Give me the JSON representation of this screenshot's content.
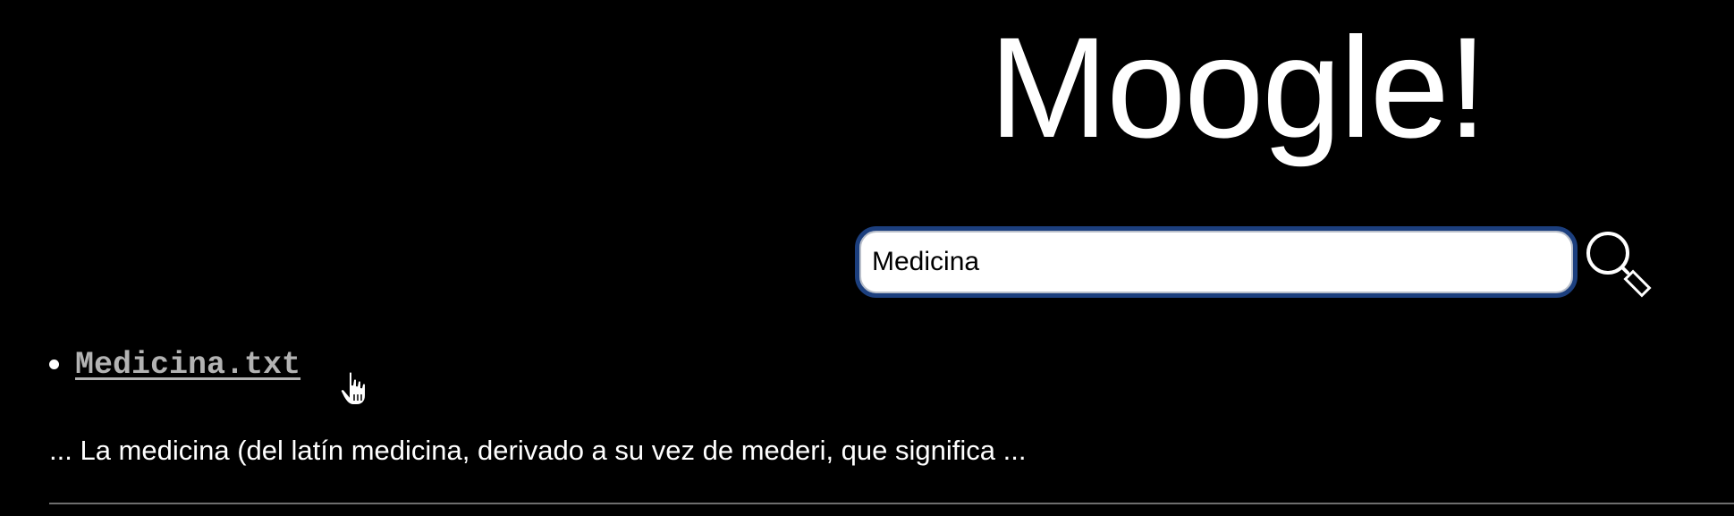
{
  "header": {
    "logo_text": "Moogle!"
  },
  "search": {
    "value": "Medicina",
    "button_icon": "search-icon"
  },
  "results": [
    {
      "title": "Medicina.txt",
      "snippet": "... La medicina (del latín medicina, derivado a su vez de mederi, que significa ..."
    }
  ],
  "colors": {
    "background": "#000000",
    "text": "#ffffff",
    "link": "#b3b3b3",
    "input_border": "#1c3f7e"
  }
}
